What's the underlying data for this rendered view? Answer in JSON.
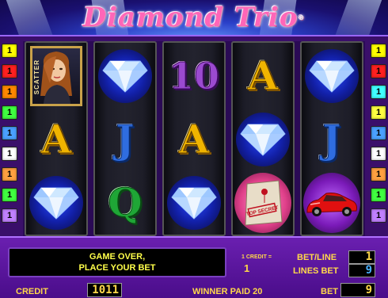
{
  "header": {
    "title": "Diamond Trio",
    "trademark": "®"
  },
  "line_indicators": {
    "left": [
      "1",
      "1",
      "1",
      "1",
      "1",
      "1",
      "1",
      "1",
      "1"
    ],
    "right": [
      "1",
      "1",
      "1",
      "1",
      "1",
      "1",
      "1",
      "1",
      "1"
    ],
    "colors": [
      "#ffff00",
      "#ff2020",
      "#ff8800",
      "#40ff40",
      "#4aa0ff",
      "#ffffff",
      "#ffa040",
      "#40ff40",
      "#c080ff"
    ]
  },
  "reels": [
    [
      "scatter",
      "A",
      "diamond"
    ],
    [
      "diamond",
      "J",
      "Q"
    ],
    [
      "10",
      "A",
      "diamond"
    ],
    [
      "A",
      "diamond",
      "top-secret"
    ],
    [
      "diamond",
      "J",
      "car"
    ]
  ],
  "symbols": {
    "scatter_label": "SCATTER",
    "top_secret_label": "TOP SECRET"
  },
  "panel": {
    "message_line1": "GAME OVER,",
    "message_line2": "PLACE YOUR BET",
    "credit_eq_label": "1 CREDIT =",
    "credit_eq_value": "1",
    "bet_line_label": "BET/LINE",
    "bet_line_value": "1",
    "lines_bet_label": "LINES BET",
    "lines_bet_value": "9",
    "credit_label": "CREDIT",
    "credit_value": "1011",
    "winner_paid": "WINNER PAID 20",
    "bet_label": "BET",
    "bet_value": "9"
  },
  "colors": {
    "accent": "#ffd84a",
    "panel": "#5a16a0",
    "title": "#ff66b8"
  }
}
